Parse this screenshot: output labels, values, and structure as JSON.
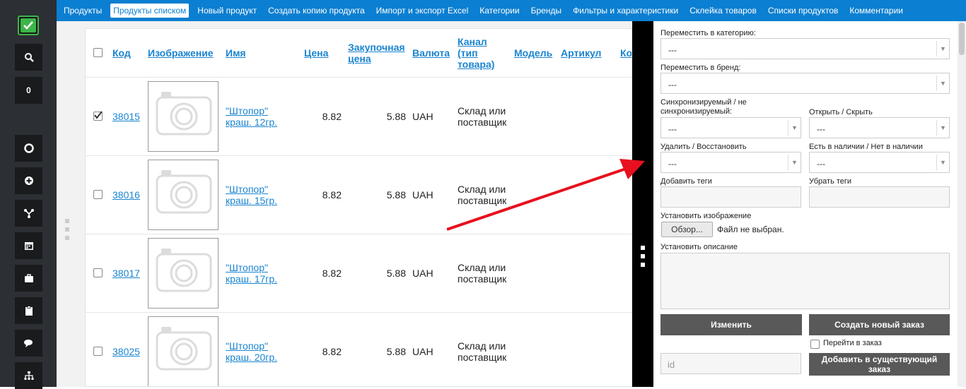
{
  "sidebar": {
    "counter": "0",
    "icons": [
      "checkmark-icon",
      "search-icon",
      "lifebuoy-icon",
      "plus-circle-icon",
      "fork-icon",
      "calendar-icon",
      "briefcase-icon",
      "clipboard-icon",
      "chat-icon",
      "sitemap-icon"
    ]
  },
  "topnav": {
    "items": [
      "Продукты",
      "Продукты списком",
      "Новый продукт",
      "Создать копию продукта",
      "Импорт и экспорт Excel",
      "Категории",
      "Бренды",
      "Фильтры и характеристики",
      "Склейка товаров",
      "Списки продуктов",
      "Комментарии"
    ],
    "active": "Продукты списком"
  },
  "table": {
    "headers": {
      "code": "Код",
      "image": "Изображение",
      "name": "Имя",
      "price": "Цена",
      "purchase_price_l1": "Закупочная",
      "purchase_price_l2": "цена",
      "currency": "Валюта",
      "channel_l1": "Канал",
      "channel_l2": "(тип",
      "channel_l3": "товара)",
      "model": "Модель",
      "article": "Артикул",
      "cut": "Ко"
    },
    "rows": [
      {
        "checked": true,
        "code": "38015",
        "name_l1": "\"Штопор\"",
        "name_l2": "краш. 12гр.",
        "price": "8.82",
        "purchase": "5.88",
        "currency": "UAH",
        "channel_l1": "Склад или",
        "channel_l2": "поставщик"
      },
      {
        "checked": false,
        "code": "38016",
        "name_l1": "\"Штопор\"",
        "name_l2": "краш. 15гр.",
        "price": "8.82",
        "purchase": "5.88",
        "currency": "UAH",
        "channel_l1": "Склад или",
        "channel_l2": "поставщик"
      },
      {
        "checked": false,
        "code": "38017",
        "name_l1": "\"Штопор\"",
        "name_l2": "краш. 17гр.",
        "price": "8.82",
        "purchase": "5.88",
        "currency": "UAH",
        "channel_l1": "Склад или",
        "channel_l2": "поставщик"
      },
      {
        "checked": false,
        "code": "38025",
        "name_l1": "\"Штопор\"",
        "name_l2": "краш. 20гр.",
        "price": "8.82",
        "purchase": "5.88",
        "currency": "UAH",
        "channel_l1": "Склад или",
        "channel_l2": "поставщик"
      }
    ]
  },
  "panel": {
    "move_category": {
      "label": "Переместить в категорию:",
      "value": "---"
    },
    "move_brand": {
      "label": "Переместить в бренд:",
      "value": "---"
    },
    "sync": {
      "label_l1": "Синхронизируемый / не",
      "label_l2": "синхронизируемый:",
      "value": "---"
    },
    "open_hide": {
      "label": "Открыть / Скрыть",
      "value": "---"
    },
    "delete_restore": {
      "label": "Удалить / Восстановить",
      "value": "---"
    },
    "availability": {
      "label": "Есть в наличии / Нет в наличии",
      "value": "---"
    },
    "add_tags": {
      "label": "Добавить теги"
    },
    "remove_tags": {
      "label": "Убрать теги"
    },
    "set_image": {
      "label": "Установить изображение",
      "browse": "Обзор...",
      "file_status": "Файл не выбран."
    },
    "set_description": {
      "label": "Установить описание"
    },
    "change_button": "Изменить",
    "new_order_button": "Создать новый заказ",
    "go_to_order": "Перейти в заказ",
    "id_placeholder": "id",
    "add_existing_l1": "Добавить в существующий",
    "add_existing_l2": "заказ"
  },
  "colors": {
    "nav": "#0b7fd1",
    "link": "#1a84d0",
    "sidebar": "#2c2f33",
    "button": "#595959",
    "arrow": "#e8101e",
    "logo": "#3cb54a"
  }
}
